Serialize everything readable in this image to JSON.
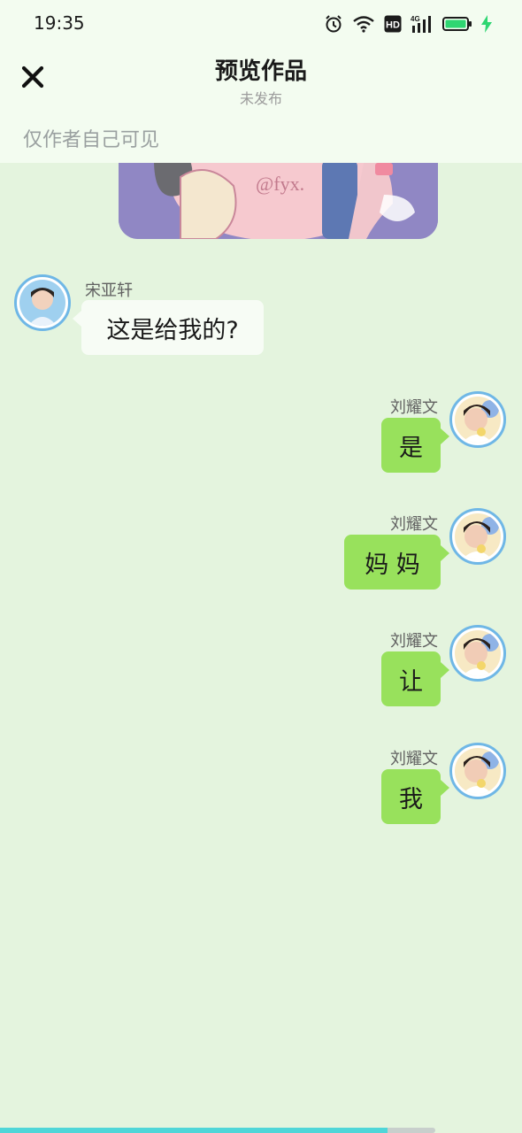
{
  "status_bar": {
    "time": "19:35",
    "network_badge": "HD",
    "signal_label": "4G",
    "icons": [
      "alarm-icon",
      "wifi-icon",
      "hd-icon",
      "cellular-signal-icon",
      "battery-icon",
      "charging-bolt-icon"
    ]
  },
  "header": {
    "close_icon": "close-icon",
    "title": "预览作品",
    "subtitle": "未发布",
    "visibility_note": "仅作者自己可见"
  },
  "messages": [
    {
      "side": "left",
      "sender": "宋亚轩",
      "text": "这是给我的?"
    },
    {
      "side": "right",
      "sender": "刘耀文",
      "text": "是"
    },
    {
      "side": "right",
      "sender": "刘耀文",
      "text": "妈 妈"
    },
    {
      "side": "right",
      "sender": "刘耀文",
      "text": "让"
    },
    {
      "side": "right",
      "sender": "刘耀文",
      "text": "我"
    }
  ],
  "progress": {
    "value": 0.89
  },
  "colors": {
    "background": "#e4f4de",
    "header_background": "#f3fcf0",
    "right_bubble": "#98e15c",
    "left_bubble": "#f7fcf5",
    "avatar_ring": "#6fb7e6",
    "progress_fill": "#4fd6d8"
  }
}
